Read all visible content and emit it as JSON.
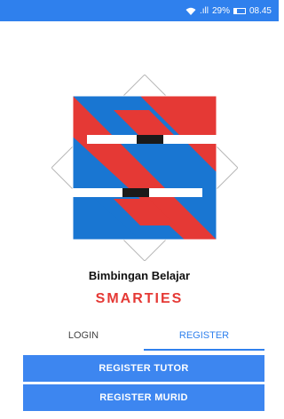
{
  "status_bar": {
    "signal_text": ".ıll",
    "battery": "29%",
    "time": "08.45",
    "wifi_icon": "wifi-icon",
    "battery_icon": "battery-icon"
  },
  "app": {
    "subtitle": "Bimbingan Belajar",
    "title": "SMARTIES"
  },
  "logo": {
    "icon": "smarties-logo",
    "colors": {
      "red": "#e53935",
      "blue": "#1976d2",
      "black": "#1a1a1a",
      "white": "#ffffff"
    }
  },
  "tabs": [
    {
      "label": "LOGIN",
      "active": false
    },
    {
      "label": "REGISTER",
      "active": true
    }
  ],
  "buttons": {
    "register_tutor": "REGISTER TUTOR",
    "register_murid": "REGISTER MURID"
  },
  "colors": {
    "accent": "#2f80ed",
    "brand_red": "#e53935"
  }
}
